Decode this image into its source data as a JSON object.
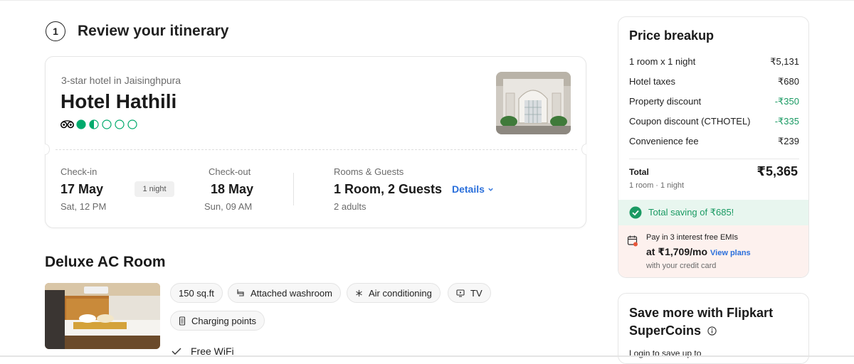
{
  "step": {
    "number": "1",
    "title": "Review your itinerary"
  },
  "hotel": {
    "subtitle": "3-star hotel in Jaisinghpura",
    "name": "Hotel Hathili",
    "rating_bubbles": 1.5,
    "checkin": {
      "label": "Check-in",
      "date": "17 May",
      "time": "Sat, 12 PM"
    },
    "nights_badge": "1 night",
    "checkout": {
      "label": "Check-out",
      "date": "18 May",
      "time": "Sun, 09 AM"
    },
    "rooms": {
      "label": "Rooms & Guests",
      "value": "1 Room, 2 Guests",
      "sub": "2 adults"
    },
    "details_link": "Details"
  },
  "room": {
    "title": "Deluxe AC Room",
    "amenities": [
      "150 sq.ft",
      "Attached washroom",
      "Air conditioning",
      "TV",
      "Charging points"
    ],
    "feature": "Free WiFi"
  },
  "price": {
    "title": "Price breakup",
    "rows": [
      {
        "label": "1 room x 1 night",
        "value": "₹5,131"
      },
      {
        "label": "Hotel taxes",
        "value": "₹680"
      },
      {
        "label": "Property discount",
        "value": "-₹350"
      },
      {
        "label": "Coupon discount (CTHOTEL)",
        "value": "-₹335"
      },
      {
        "label": "Convenience fee",
        "value": "₹239"
      }
    ],
    "total_label": "Total",
    "total_value": "₹5,365",
    "total_sub": "1 room · 1 night",
    "saving": "Total saving of ₹685!",
    "emi": {
      "line1": "Pay in 3 interest free EMIs",
      "amount": "at ₹1,709/mo",
      "link": "View plans",
      "line3": "with your credit card"
    }
  },
  "supercoins": {
    "title": "Save more with Flipkart SuperCoins",
    "sub": "Login to save up to"
  },
  "colors": {
    "accent_blue": "#2a6fdb",
    "discount_green": "#1a9a63",
    "ta_green": "#00aa6c"
  }
}
